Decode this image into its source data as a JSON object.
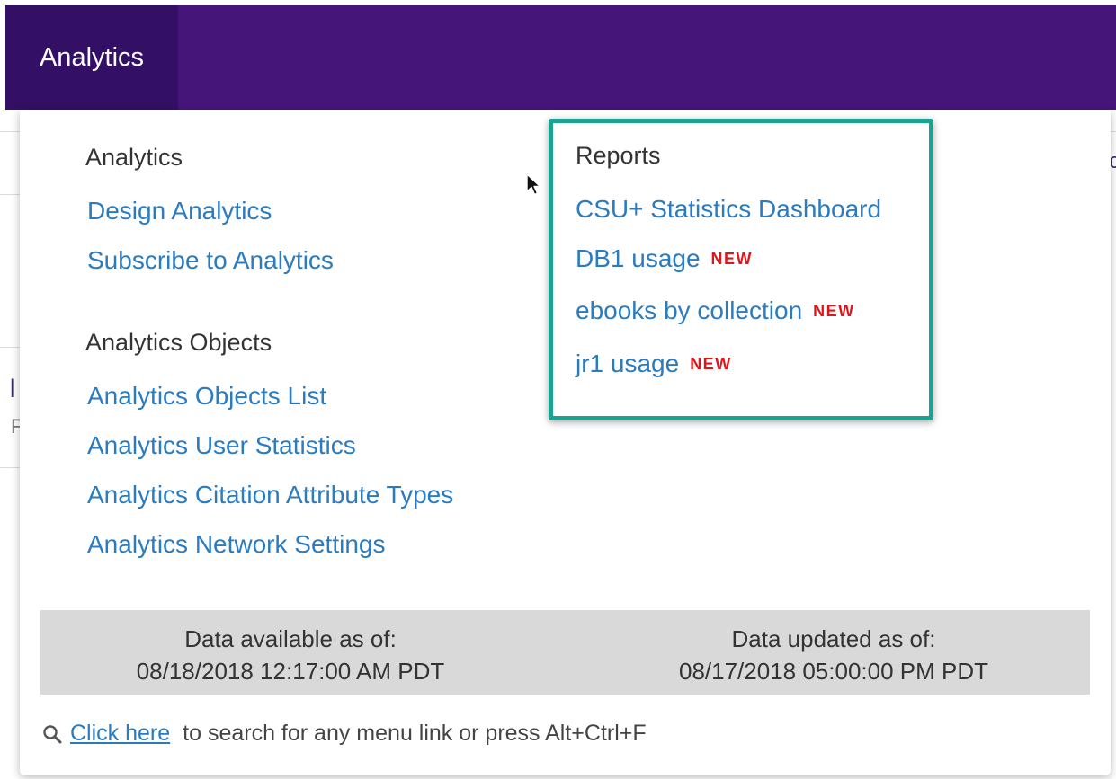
{
  "nav": {
    "active_tab": "Analytics"
  },
  "menu": {
    "analytics_section": {
      "heading": "Analytics",
      "links": [
        "Design Analytics",
        "Subscribe to Analytics"
      ]
    },
    "objects_section": {
      "heading": "Analytics Objects",
      "links": [
        "Analytics Objects List",
        "Analytics User Statistics",
        "Analytics Citation Attribute Types",
        "Analytics Network Settings"
      ]
    },
    "reports_section": {
      "heading": "Reports",
      "links": [
        {
          "label": "CSU+ Statistics Dashboard",
          "badge": ""
        },
        {
          "label": "DB1 usage",
          "badge": "NEW"
        },
        {
          "label": "ebooks by collection",
          "badge": "NEW"
        },
        {
          "label": "jr1 usage",
          "badge": "NEW"
        }
      ]
    }
  },
  "data_status": {
    "available_label": "Data available as of:",
    "available_value": "08/18/2018 12:17:00 AM PDT",
    "updated_label": "Data updated as of:",
    "updated_value": "08/17/2018 05:00:00 PM PDT"
  },
  "footer": {
    "search_icon": "search-icon",
    "link_text": "Click here",
    "rest_text": "to search for any menu link or press Alt+Ctrl+F"
  },
  "colors": {
    "nav_bg": "#45157a",
    "nav_active": "#331065",
    "link": "#2a7bc0",
    "badge": "#e0151b",
    "highlight_border": "#1aa391"
  }
}
